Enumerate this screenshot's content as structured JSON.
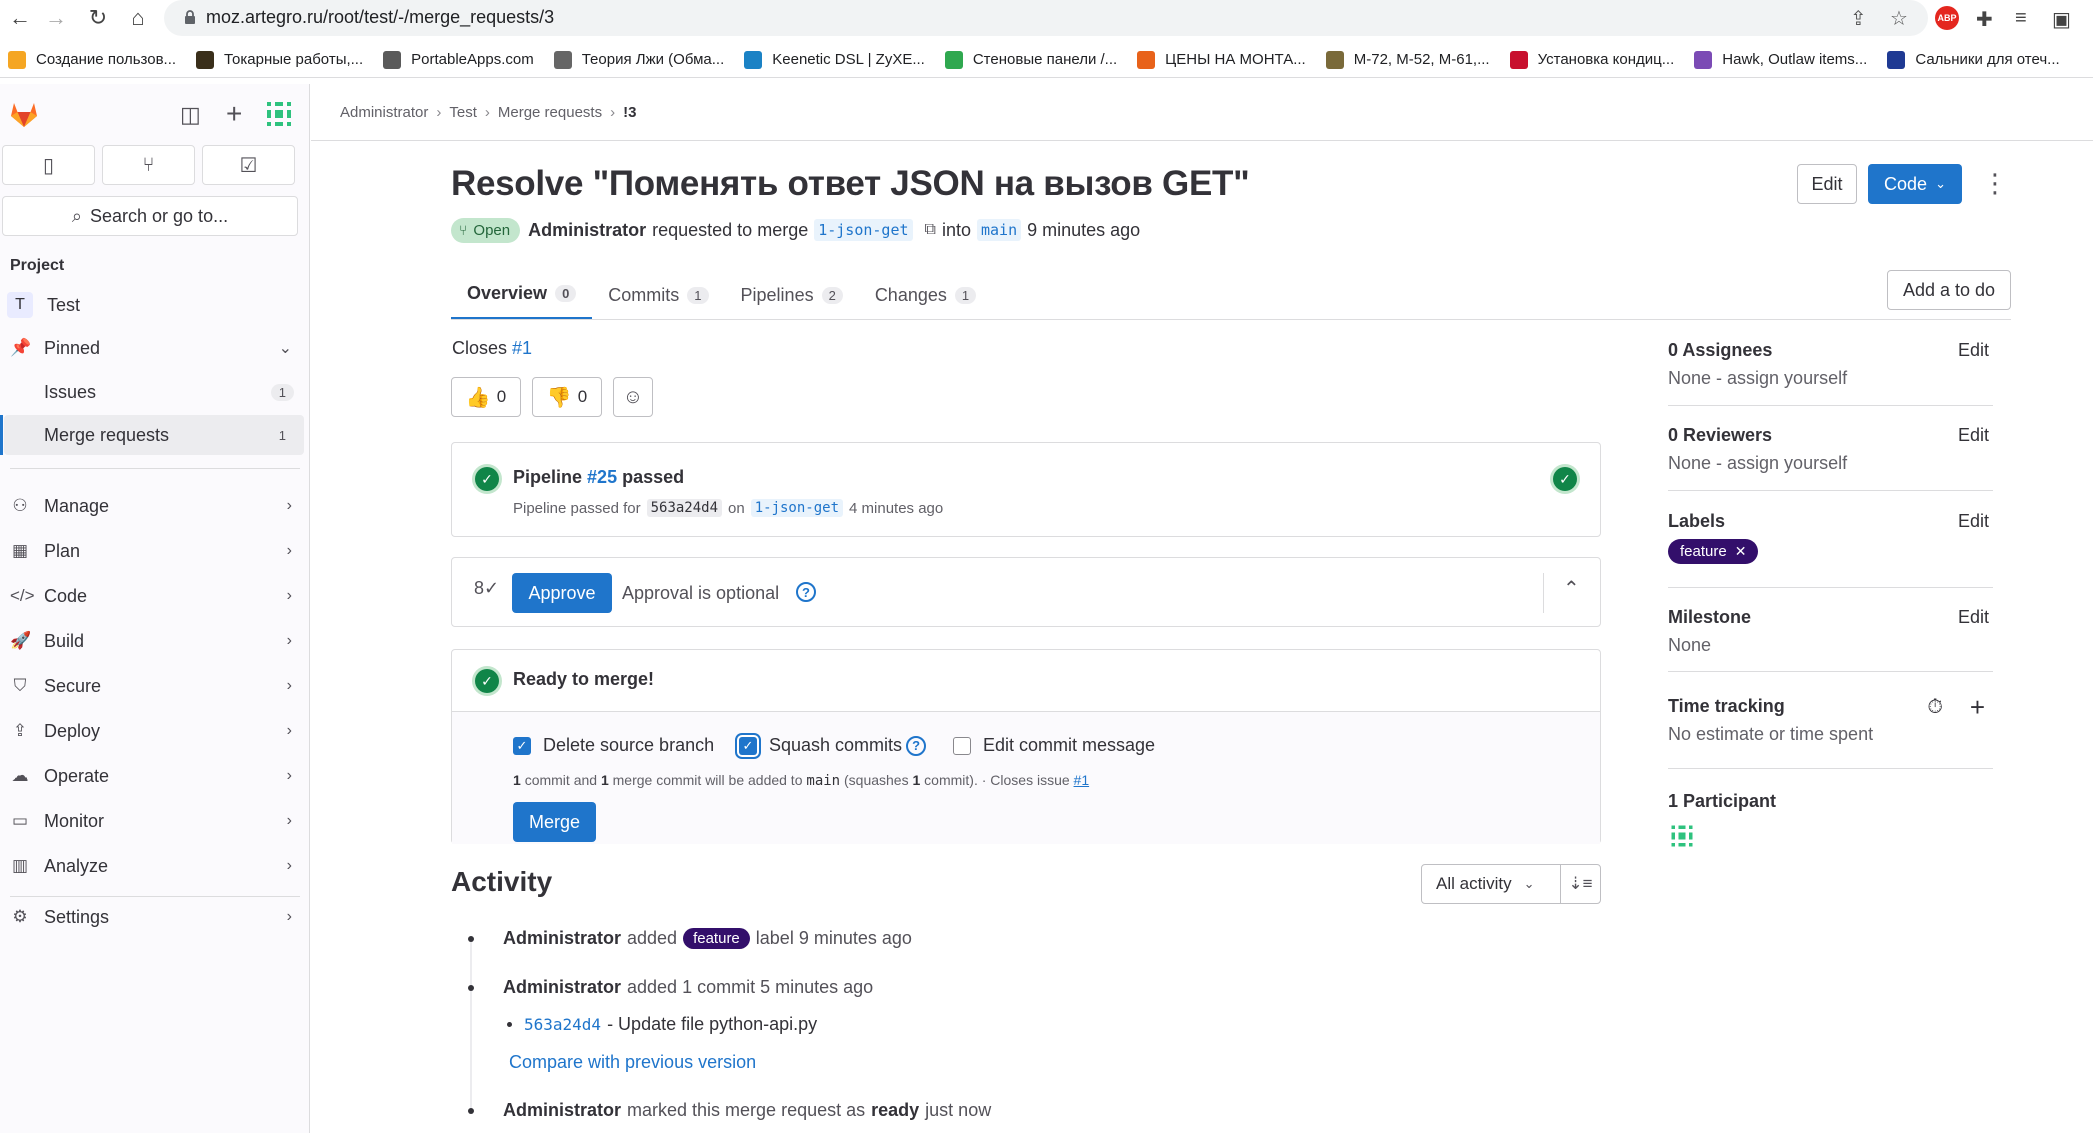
{
  "browser": {
    "url": "moz.artegro.ru/root/test/-/merge_requests/3",
    "abp_label": "ABP",
    "bookmarks": [
      {
        "label": "Создание пользов...",
        "color": "#f5a623"
      },
      {
        "label": "Токарные работы,...",
        "color": "#3a2f1a"
      },
      {
        "label": "PortableApps.com",
        "color": "#5a5a5a"
      },
      {
        "label": "Теория Лжи (Обма...",
        "color": "#666666"
      },
      {
        "label": "Keenetic DSL | ZyXE...",
        "color": "#1b82c5"
      },
      {
        "label": "Стеновые панели /...",
        "color": "#2fa84f"
      },
      {
        "label": "ЦЕНЫ НА МОНТА...",
        "color": "#e8621a"
      },
      {
        "label": "М-72, М-52, М-61,...",
        "color": "#7a6a3a"
      },
      {
        "label": "Установка кондиц...",
        "color": "#c8102e"
      },
      {
        "label": "Hawk, Outlaw items...",
        "color": "#7b4bb5"
      },
      {
        "label": "Сальники для отеч...",
        "color": "#1f3a93"
      }
    ]
  },
  "sidebar": {
    "search_label": "Search or go to...",
    "project_heading": "Project",
    "project_avatar": "T",
    "project_name": "Test",
    "pinned_label": "Pinned",
    "pinned": [
      {
        "label": "Issues",
        "count": "1"
      },
      {
        "label": "Merge requests",
        "count": "1"
      }
    ],
    "sections": [
      "Manage",
      "Plan",
      "Code",
      "Build",
      "Secure",
      "Deploy",
      "Operate",
      "Monitor",
      "Analyze"
    ],
    "settings_label": "Settings"
  },
  "breadcrumb": [
    "Administrator",
    "Test",
    "Merge requests",
    "!3"
  ],
  "header": {
    "title": "Resolve \"Поменять ответ JSON на вызов GET\"",
    "edit_label": "Edit",
    "code_label": "Code",
    "status": "Open",
    "author": "Administrator",
    "requested_text": "requested to merge",
    "source_branch": "1-json-get",
    "into_text": "into",
    "target_branch": "main",
    "time": "9 minutes ago"
  },
  "tabs": [
    {
      "label": "Overview",
      "count": "0"
    },
    {
      "label": "Commits",
      "count": "1"
    },
    {
      "label": "Pipelines",
      "count": "2"
    },
    {
      "label": "Changes",
      "count": "1"
    }
  ],
  "add_todo_label": "Add a to do",
  "closes": {
    "text": "Closes",
    "ref": "#1"
  },
  "awards": {
    "thumbs_up": "0",
    "thumbs_down": "0"
  },
  "pipeline": {
    "label": "Pipeline",
    "ref": "#25",
    "status": "passed",
    "sub_prefix": "Pipeline passed for",
    "sha": "563a24d4",
    "on_text": "on",
    "branch": "1-json-get",
    "time": "4 minutes ago"
  },
  "approval": {
    "button": "Approve",
    "text": "Approval is optional"
  },
  "merge": {
    "title": "Ready to merge!",
    "delete_source": "Delete source branch",
    "squash": "Squash commits",
    "edit_message": "Edit commit message",
    "info_n1": "1",
    "info_t1": "commit and",
    "info_n2": "1",
    "info_t2": "merge commit will be added to",
    "info_branch": "main",
    "info_t3": "(squashes",
    "info_n3": "1",
    "info_t4": "commit). · Closes issue",
    "info_issue": "#1",
    "button": "Merge",
    "delete_source_checked": true,
    "squash_checked": true,
    "edit_message_checked": false
  },
  "activity": {
    "title": "Activity",
    "filter": "All activity",
    "items": [
      {
        "author": "Administrator",
        "pre": "added",
        "label": "feature",
        "post": "label 9 minutes ago"
      },
      {
        "author": "Administrator",
        "pre": "added 1 commit 5 minutes ago"
      },
      {
        "author": "Administrator",
        "pre": "marked this merge request as",
        "strong": "ready",
        "post": "just now"
      }
    ],
    "commit": {
      "sha": "563a24d4",
      "message": "- Update file python-api.py"
    },
    "compare_link": "Compare with previous version"
  },
  "right_sidebar": {
    "assignees_heading": "0 Assignees",
    "assignees_value": "None - assign yourself",
    "reviewers_heading": "0 Reviewers",
    "reviewers_value": "None - assign yourself",
    "labels_heading": "Labels",
    "label": "feature",
    "milestone_heading": "Milestone",
    "milestone_value": "None",
    "time_heading": "Time tracking",
    "time_value": "No estimate or time spent",
    "participants_heading": "1 Participant",
    "edit_label": "Edit"
  },
  "colors": {
    "primary": "#1f75cb",
    "success": "#108548",
    "label": "#330f6b"
  }
}
